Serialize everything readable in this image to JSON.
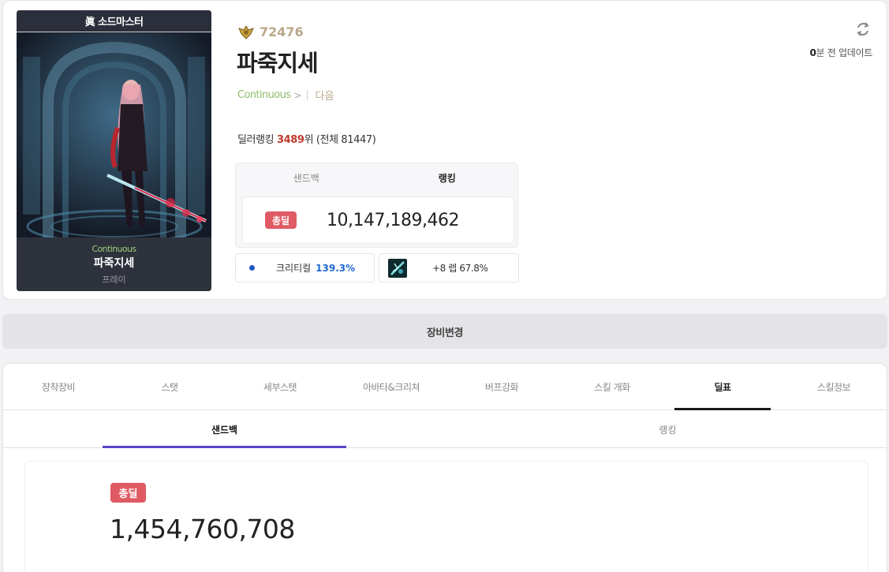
{
  "profile": {
    "job_title": "眞 소드마스터",
    "guild": "Continuous",
    "name": "파죽지세",
    "server": "프레이",
    "fame": "72476",
    "title": "파죽지세",
    "guild_link": "Continuous",
    "guild_chevron": ">",
    "adventure_link": "다음",
    "updated_value": "0",
    "updated_text": "분 전 업데이트",
    "dealer_rank_label": "딜러랭킹 ",
    "dealer_rank_value": "3489",
    "dealer_rank_suffix": "위 (전체 81447)"
  },
  "deal_summary": {
    "tabs": [
      "샌드백",
      "랭킹"
    ],
    "badge": "총딜",
    "value": "10,147,189,462"
  },
  "stats": {
    "crit_label": "크리티컬",
    "crit_value": "139.3%",
    "skill_label": "+8 렙 67.8%"
  },
  "equip_change": "장비변경",
  "main_tabs": [
    "장착장비",
    "스탯",
    "세부스탯",
    "아바타&크리쳐",
    "버프강화",
    "스킬 개화",
    "딜표",
    "스킬정보"
  ],
  "sub_tabs": [
    "샌드백",
    "랭킹"
  ],
  "result": {
    "badge": "총딜",
    "value": "1,454,760,708"
  },
  "colors": {
    "accent_red": "#e05a64",
    "rank_red": "#c0392b",
    "guild_green": "#8dbd6a",
    "fame_gold": "#b9a88a",
    "crit_blue": "#1f6ad4",
    "subtab_purple": "#5a46c8"
  }
}
